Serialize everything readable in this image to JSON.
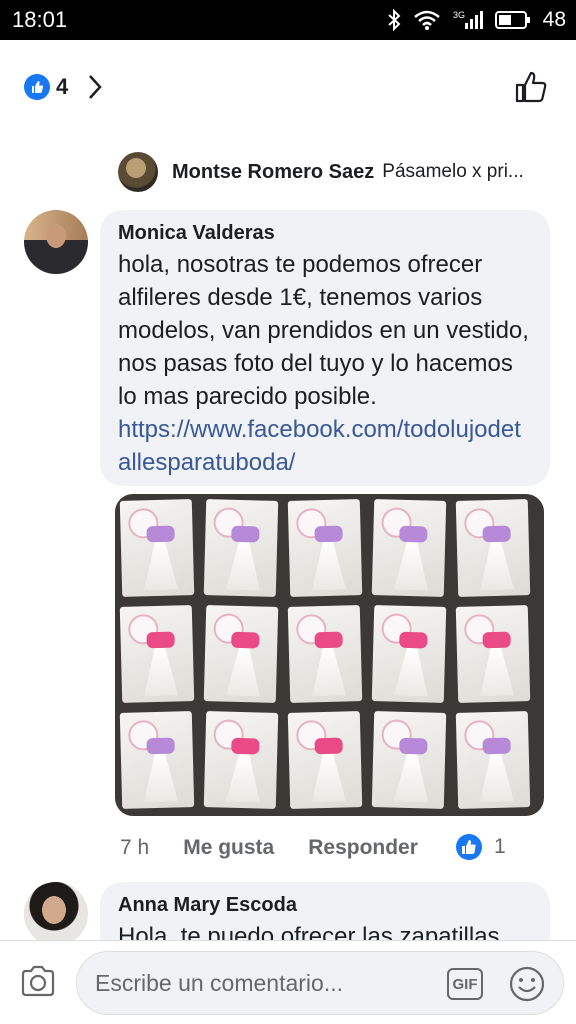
{
  "status_bar": {
    "time": "18:01",
    "network": "3G",
    "battery": "48",
    "icons": [
      "bluetooth-icon",
      "wifi-icon",
      "signal-icon",
      "battery-icon"
    ]
  },
  "header": {
    "like_count": "4",
    "icons": [
      "like-badge-icon",
      "chevron-right-icon",
      "thumbs-up-icon"
    ]
  },
  "reply_preview": {
    "author": "Montse Romero Saez",
    "snippet": "Pásamelo x pri..."
  },
  "comments": [
    {
      "author": "Monica Valderas",
      "text": "hola, nosotras te podemos ofrecer alfileres desde 1€, tenemos varios modelos, van prendidos en un vestido, nos pasas foto del tuyo y lo hacemos lo mas parecido posible.",
      "link": "https://www.facebook.com/todolujodetallesparatuboda/",
      "time": "7 h",
      "like_label": "Me gusta",
      "reply_label": "Responder",
      "reaction_count": "1"
    },
    {
      "author": "Anna Mary Escoda",
      "text": "Hola, te puedo ofrecer las zapatillas..."
    }
  ],
  "composer": {
    "placeholder": "Escribe un comentario...",
    "gif_label": "GIF",
    "icons": [
      "camera-icon",
      "gif-icon",
      "smiley-icon"
    ]
  },
  "colors": {
    "accent": "#1877f2",
    "link": "#385898",
    "bubble": "#f0f2f5",
    "meta": "#65676b"
  }
}
